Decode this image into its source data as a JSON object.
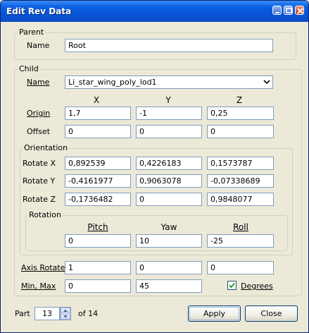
{
  "window": {
    "title": "Edit Rev Data"
  },
  "parent": {
    "group_label": "Parent",
    "name_label": "Name",
    "name_value": "Root"
  },
  "child": {
    "group_label": "Child",
    "name_label": "Name",
    "name_selected": "Li_star_wing_poly_lod1",
    "headers": {
      "x": "X",
      "y": "Y",
      "z": "Z"
    },
    "origin": {
      "label": "Origin",
      "x": "1,7",
      "y": "-1",
      "z": "0,25"
    },
    "offset": {
      "label": "Offset",
      "x": "0",
      "y": "0",
      "z": "0"
    },
    "orientation": {
      "group_label": "Orientation",
      "rotate_x": {
        "label": "Rotate X",
        "x": "0,892539",
        "y": "0,4226183",
        "z": "0,1573787"
      },
      "rotate_y": {
        "label": "Rotate Y",
        "x": "-0,4161977",
        "y": "0,9063078",
        "z": "-0,07338689"
      },
      "rotate_z": {
        "label": "Rotate Z",
        "x": "-0,1736482",
        "y": "0",
        "z": "0,9848077"
      },
      "rotation": {
        "group_label": "Rotation",
        "pitch_label": "Pitch",
        "yaw_label": "Yaw",
        "roll_label": "Roll",
        "pitch": "0",
        "yaw": "10",
        "roll": "-25"
      }
    },
    "axis_rotate": {
      "label": "Axis Rotate",
      "x": "1",
      "y": "0",
      "z": "0"
    },
    "min_max": {
      "label": "Min, Max",
      "min": "0",
      "max": "45"
    },
    "degrees": {
      "label": "Degrees",
      "checked": true
    }
  },
  "footer": {
    "part_label": "Part",
    "part_value": "13",
    "of_label": "of 14",
    "apply_label": "Apply",
    "close_label": "Close"
  },
  "colors": {
    "titlebar": "#0753d6",
    "dialog_bg": "#ece9d8",
    "field_border": "#7f9db9"
  },
  "icons": [
    "minimize-icon",
    "maximize-icon",
    "close-icon",
    "chevron-down-icon",
    "checkmark-icon",
    "spin-up-icon",
    "spin-down-icon"
  ]
}
